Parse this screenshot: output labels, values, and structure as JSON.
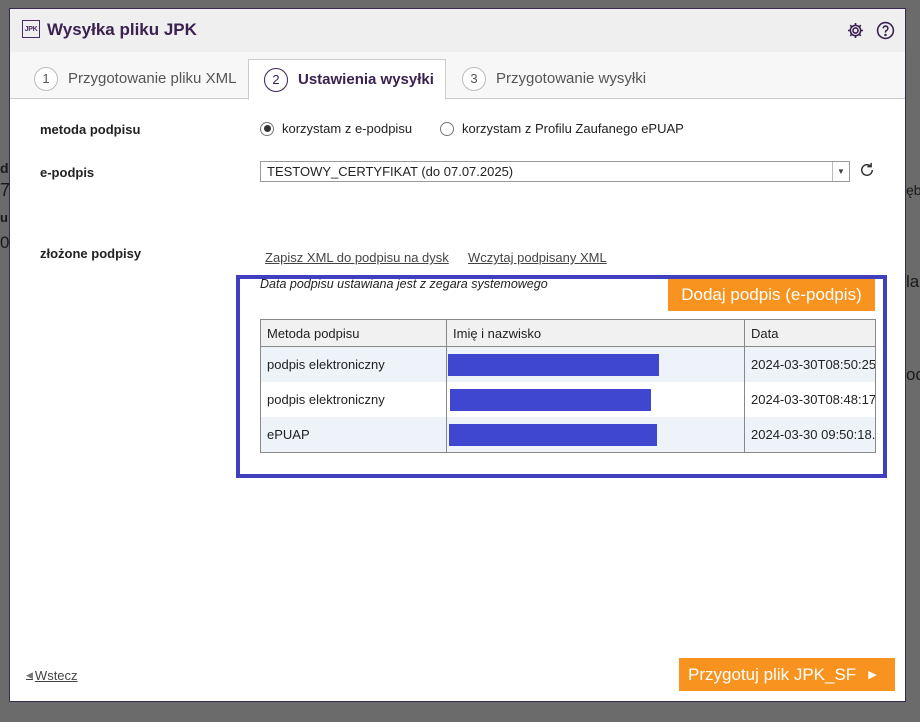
{
  "background": {
    "fragments": [
      "d",
      "7",
      "u",
      "0",
      "ęb",
      "la",
      "od"
    ]
  },
  "window": {
    "logo_text": "JPK",
    "title": "Wysyłka pliku JPK",
    "icons": [
      "gear-icon",
      "help-icon"
    ]
  },
  "tabs": [
    {
      "number": "1",
      "label": "Przygotowanie pliku XML",
      "active": false
    },
    {
      "number": "2",
      "label": "Ustawienia wysyłki",
      "active": true
    },
    {
      "number": "3",
      "label": "Przygotowanie wysyłki",
      "active": false
    }
  ],
  "signature_method": {
    "label": "metoda podpisu",
    "options": [
      {
        "label": "korzystam z e-podpisu",
        "selected": true
      },
      {
        "label": "korzystam z Profilu Zaufanego ePUAP",
        "selected": false
      }
    ]
  },
  "e_signature": {
    "label": "e-podpis",
    "selected_value": "TESTOWY_CERTYFIKAT (do 07.07.2025)"
  },
  "submitted_signatures": {
    "label": "złożone podpisy",
    "save_link": "Zapisz XML do podpisu na dysk",
    "load_link": "Wczytaj podpisany XML",
    "note": "Data podpisu ustawiana jest z zegara systemowego",
    "add_button": "Dodaj podpis (e-podpis)",
    "table": {
      "columns": [
        "Metoda podpisu",
        "Imię i nazwisko",
        "Data"
      ],
      "rows": [
        {
          "method": "podpis elektroniczny",
          "name_redacted": true,
          "date": "2024-03-30T08:50:25"
        },
        {
          "method": "podpis elektroniczny",
          "name_redacted": true,
          "date": "2024-03-30T08:48:17"
        },
        {
          "method": "ePUAP",
          "name_redacted": true,
          "date": "2024-03-30 09:50:18."
        }
      ]
    }
  },
  "footer": {
    "back_label": "Wstecz",
    "next_button": "Przygotuj plik JPK_SF"
  },
  "colors": {
    "accent_orange": "#f7931e",
    "brand_purple": "#3b2150",
    "highlight_blue": "#3f3fbf",
    "redaction_blue": "#3f47d1"
  }
}
